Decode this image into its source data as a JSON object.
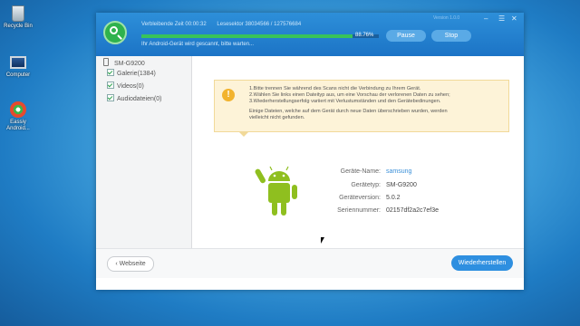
{
  "desktop": {
    "icons": [
      {
        "label": "Recycle Bin",
        "icon": "recycle-bin-icon"
      },
      {
        "label": "Computer",
        "icon": "computer-icon"
      },
      {
        "label": "Eassiy Android...",
        "icon": "app-icon"
      }
    ]
  },
  "header": {
    "remaining_time": "Verbleibende Zeit 00:00:32",
    "read_sector": "Lesesektor 38034566 / 127576684",
    "progress": 0.8876,
    "progress_text": "88.76%",
    "status": "Ihr Android-Gerät wird gescannt, bitte warten...",
    "pause_label": "Pause",
    "stop_label": "Stop",
    "version": "Version 1.0.0",
    "colors": {
      "accent": "#1c74c6",
      "progress": "#38c35b"
    }
  },
  "sidebar": {
    "device": "SM-G9200",
    "items": [
      {
        "label": "Galerie(1384)"
      },
      {
        "label": "Videos(0)"
      },
      {
        "label": "Audiodateien(0)"
      }
    ]
  },
  "notice": {
    "lines": [
      "1.Bitte trennen Sie während des Scans nicht die Verbindung zu Ihrem Gerät.",
      "2.Wählen Sie links einen Dateityp aus, um eine Vorschau der verlorenen Daten zu sehen;",
      "3.Wiederherstellungserfolg variiert mit Verlustumständen und den Gerätebedinungen.",
      "Einige Dateien, welche auf dem Gerät durch neue Daten überschrieben wurden, werden",
      "vielleicht nicht gefunden."
    ]
  },
  "device_info": {
    "name_label": "Geräte-Name:",
    "name_value": "samsung",
    "type_label": "Gerätetyp:",
    "type_value": "SM-G9200",
    "version_label": "Geräteversion:",
    "version_value": "5.0.2",
    "serial_label": "Seriennummer:",
    "serial_value": "02157df2a2c7ef3e"
  },
  "footer": {
    "back_label": "Webseite",
    "restore_label": "Wiederherstellen"
  }
}
